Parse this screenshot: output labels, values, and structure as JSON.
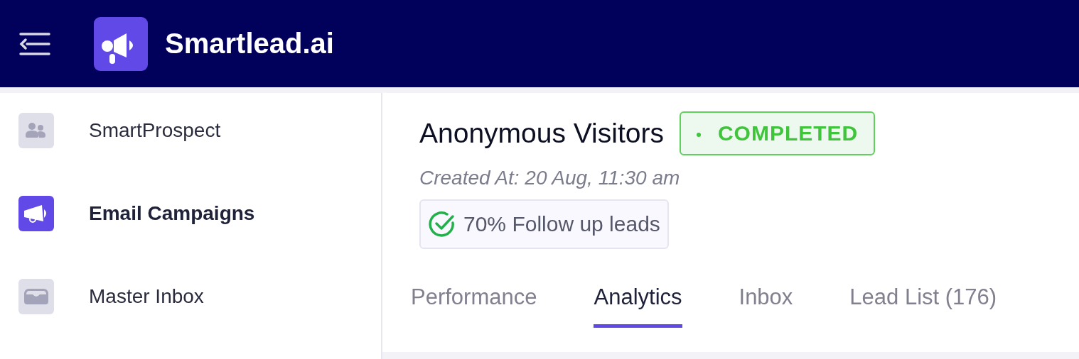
{
  "header": {
    "brand": "Smartlead.ai"
  },
  "sidebar": {
    "items": [
      {
        "label": "SmartProspect",
        "selected": false
      },
      {
        "label": "Email Campaigns",
        "selected": true
      },
      {
        "label": "Master Inbox",
        "selected": false
      }
    ]
  },
  "campaign": {
    "title": "Anonymous Visitors",
    "status": "COMPLETED",
    "created": "Created At: 20 Aug, 11:30 am",
    "follow_up": "70% Follow up leads"
  },
  "tabs": [
    {
      "label": "Performance",
      "selected": false
    },
    {
      "label": "Analytics",
      "selected": true
    },
    {
      "label": "Inbox",
      "selected": false
    },
    {
      "label": "Lead List (176)",
      "selected": false
    }
  ]
}
